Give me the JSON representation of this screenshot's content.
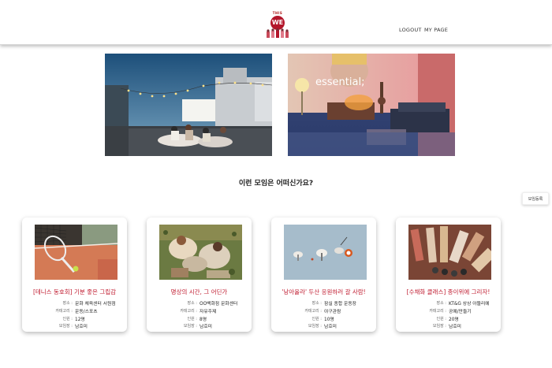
{
  "header": {
    "logo_top_text": "THIS",
    "logo_badge_text": "WE",
    "logout_label": "LOGOUT",
    "mypage_label": "MY PAGE"
  },
  "banners": [
    {
      "alt": "rooftop outdoor movie night"
    },
    {
      "alt": "essential. projector living room",
      "overlay_text": "essential;"
    }
  ],
  "section_title": "이런 모임은 어떠신가요?",
  "create_button_label": "모임등록",
  "labels": {
    "place": "장소 :",
    "category": "카테고리 :",
    "capacity": "인원 :",
    "leader": "모임장 :"
  },
  "cards": [
    {
      "title": "[테니스 동호회] 기분 좋은 그립감",
      "place": "문화 체육센터 서원점",
      "category": "운동/스포츠",
      "capacity": "12명",
      "leader": "남호미"
    },
    {
      "title": "명상의 시간, 그 어딘가",
      "place": "OO백화점 문화센터",
      "category": "자유주제",
      "capacity": "8명",
      "leader": "남호미"
    },
    {
      "title": "'낭아올라' 두산 응원하러 갈 사람!",
      "place": "잠실 종합 운동장",
      "category": "야구관람",
      "capacity": "10명",
      "leader": "남호미"
    },
    {
      "title": "[수채화 클래스] 종이위에 그리자!",
      "place": "KT&G 상상 아뜰리에",
      "category": "공예/만들기",
      "capacity": "20명",
      "leader": "남호미"
    }
  ],
  "colors": {
    "accent": "#c01c30",
    "logo": "#b3162b"
  }
}
